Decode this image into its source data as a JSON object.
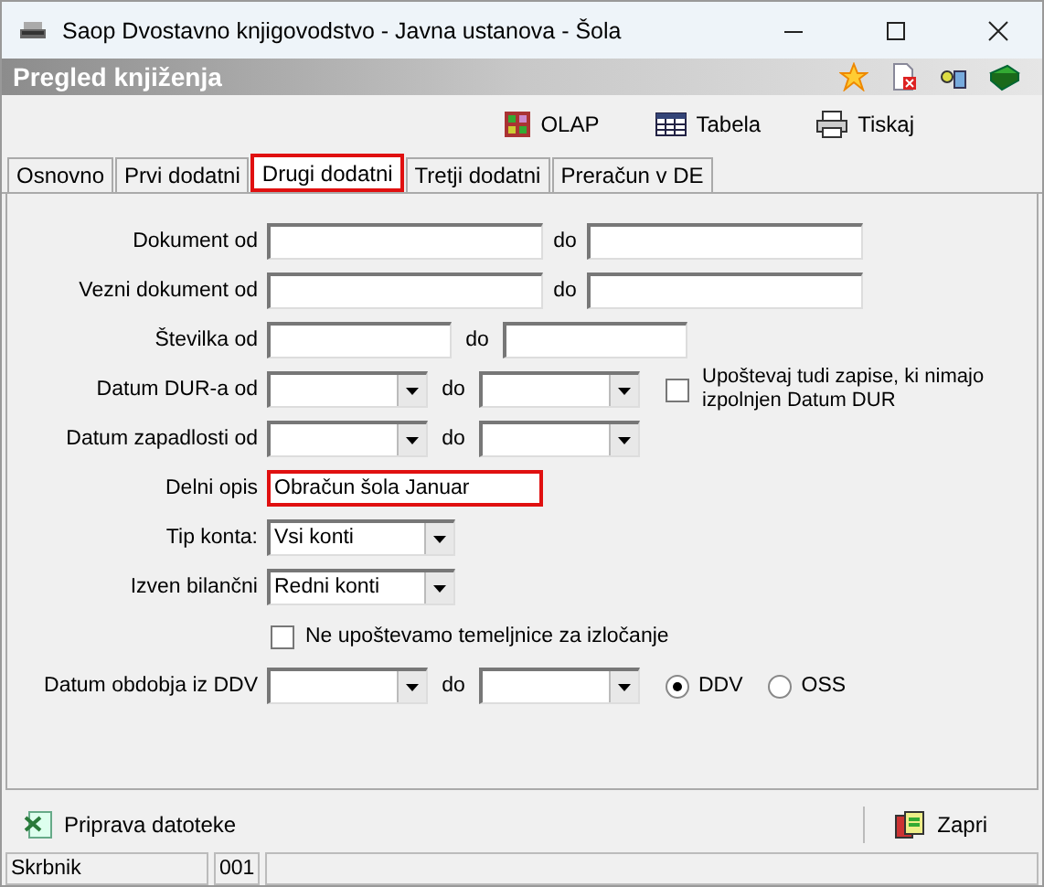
{
  "window": {
    "title": "Saop Dvostavno knjigovodstvo - Javna ustanova - Šola"
  },
  "header": {
    "title": "Pregled knjiženja"
  },
  "toolbar": [
    {
      "label": "OLAP",
      "kind": "olap"
    },
    {
      "label": "Tabela",
      "kind": "table"
    },
    {
      "label": "Tiskaj",
      "kind": "print"
    }
  ],
  "tabs": [
    {
      "label": "Osnovno",
      "selected": false,
      "highlighted": false
    },
    {
      "label": "Prvi dodatni",
      "selected": false,
      "highlighted": false
    },
    {
      "label": "Drugi dodatni",
      "selected": true,
      "highlighted": true
    },
    {
      "label": "Tretji dodatni",
      "selected": false,
      "highlighted": false
    },
    {
      "label": "Preračun v DE",
      "selected": false,
      "highlighted": false
    }
  ],
  "rows": [
    {
      "kind": "range-text",
      "label": "Dokument od",
      "to_label": "do"
    },
    {
      "kind": "range-text",
      "label": "Vezni dokument od",
      "to_label": "do"
    },
    {
      "kind": "range-number",
      "label": "Številka od",
      "to_label": "do"
    },
    {
      "kind": "range-combo",
      "label": "Datum DUR-a od",
      "to_label": "do",
      "option": {
        "label": "Upoštevaj tudi zapise, ki nimajo izpolnjen Datum DUR",
        "checked": false
      }
    },
    {
      "kind": "range-combo",
      "label": "Datum zapadlosti od",
      "to_label": "do"
    },
    {
      "kind": "text",
      "label": "Delni opis",
      "value": "Obračun šola Januar",
      "highlighted": true
    },
    {
      "kind": "combo",
      "label": "Tip konta:",
      "value": "Vsi konti"
    },
    {
      "kind": "combo",
      "label": "Izven bilančni",
      "value": "Redni konti"
    },
    {
      "kind": "checkbox",
      "label": "Ne upoštevamo temeljnice za izločanje",
      "checked": false
    },
    {
      "kind": "range-combo",
      "label": "Datum obdobja iz DDV",
      "to_label": "do",
      "radios": [
        {
          "label": "DDV",
          "selected": true
        },
        {
          "label": "OSS",
          "selected": false
        }
      ]
    }
  ],
  "footer": {
    "left": {
      "label": "Priprava datoteke"
    },
    "right": {
      "label": "Zapri"
    }
  },
  "status_bar": [
    "Skrbnik",
    "001"
  ]
}
